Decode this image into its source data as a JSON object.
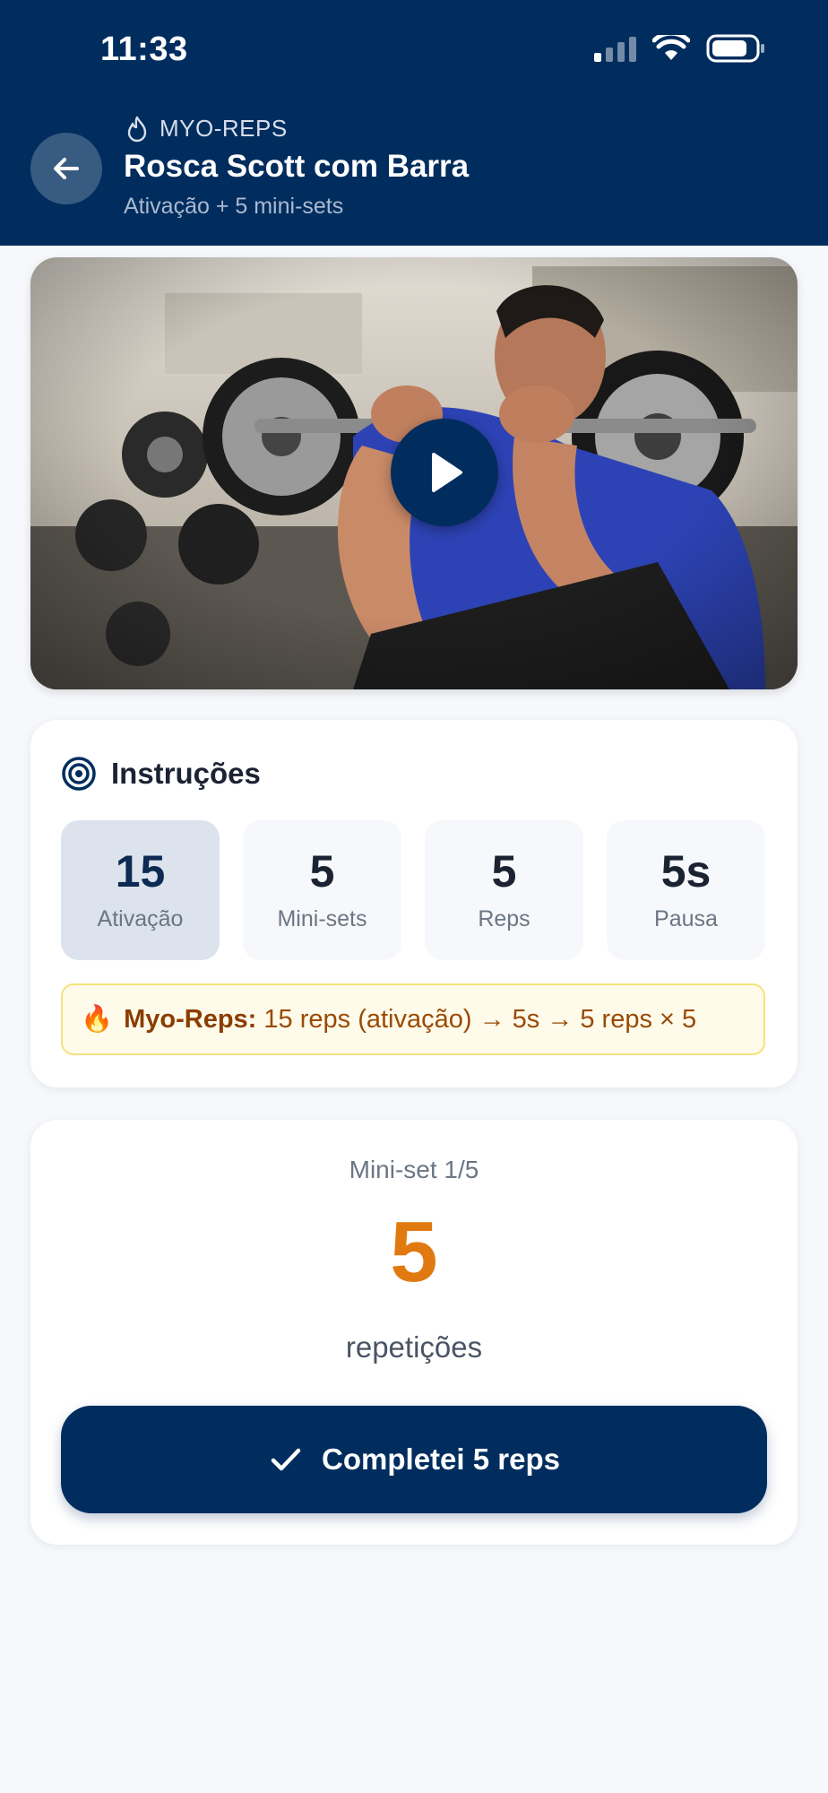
{
  "status_bar": {
    "time": "11:33"
  },
  "header": {
    "tag": "MYO-REPS",
    "title": "Rosca Scott com Barra",
    "subtitle": "Ativação + 5 mini-sets"
  },
  "video": {
    "play_icon": "play-icon"
  },
  "instructions": {
    "title": "Instruções",
    "stats": [
      {
        "value": "15",
        "label": "Ativação",
        "active": true
      },
      {
        "value": "5",
        "label": "Mini-sets",
        "active": false
      },
      {
        "value": "5",
        "label": "Reps",
        "active": false
      },
      {
        "value": "5s",
        "label": "Pausa",
        "active": false
      }
    ],
    "note": {
      "emoji": "🔥",
      "strong": "Myo-Reps:",
      "text": "15 reps (ativação) → 5s → 5 reps × 5"
    }
  },
  "current_set": {
    "label": "Mini-set 1/5",
    "count": "5",
    "unit": "repetições",
    "button_label": "Completei 5 reps"
  },
  "colors": {
    "primary": "#002d5e",
    "accent": "#e07a10",
    "note_bg": "#fffbea"
  }
}
